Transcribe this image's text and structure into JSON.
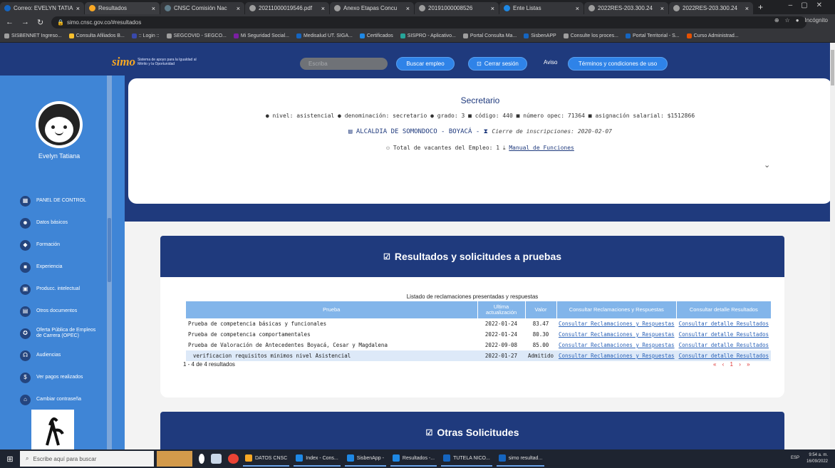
{
  "browser": {
    "tabs": [
      {
        "label": "Correo: EVELYN TATIA",
        "color": "#1565c0"
      },
      {
        "label": "Resultados",
        "color": "#f9a825"
      },
      {
        "label": "CNSC Comisión Nac",
        "color": "#607d8b"
      },
      {
        "label": "20211000019546.pdf",
        "color": "#9e9e9e"
      },
      {
        "label": "Anexo Etapas Concu",
        "color": "#9e9e9e"
      },
      {
        "label": "20191000008526",
        "color": "#9e9e9e"
      },
      {
        "label": "Ente Listas",
        "color": "#1e88e5"
      },
      {
        "label": "2022RES-203.300.24",
        "color": "#9e9e9e"
      },
      {
        "label": "2022RES-203.300.24",
        "color": "#9e9e9e"
      }
    ],
    "new_tab": "+",
    "url": "simo.cnsc.gov.co/#resultados",
    "incognito_label": "Incógnito",
    "bookmarks": [
      {
        "label": "SISBENNET Ingreso...",
        "color": "#9e9e9e"
      },
      {
        "label": "Consulta Afiliados B...",
        "color": "#fbc02d"
      },
      {
        "label": ":: Login ::",
        "color": "#3949ab"
      },
      {
        "label": "SEGCOVID - SEGCO...",
        "color": "#9e9e9e"
      },
      {
        "label": "Mi Seguridad Social...",
        "color": "#7b1fa2"
      },
      {
        "label": "Medisalud UT. SIGA...",
        "color": "#1565c0"
      },
      {
        "label": "Certificados",
        "color": "#1e88e5"
      },
      {
        "label": "SISPRO - Aplicativo...",
        "color": "#26a69a"
      },
      {
        "label": "Portal Consulta Ma...",
        "color": "#9e9e9e"
      },
      {
        "label": "SisbenAPP",
        "color": "#1565c0"
      },
      {
        "label": "Consulte los proces...",
        "color": "#9e9e9e"
      },
      {
        "label": "Portal Territorial - S...",
        "color": "#1565c0"
      },
      {
        "label": "Curso Administrad...",
        "color": "#e65100"
      }
    ]
  },
  "header": {
    "logo": "simo",
    "logo_caption": "Sistema de apoyo para la Igualdad al Mérito y la Oportunidad",
    "search_placeholder": "Escriba",
    "buscar_empleo": "Buscar empleo",
    "cerrar_sesion": "Cerrar sesión",
    "aviso": "Aviso",
    "terminos": "Términos y condiciones de uso"
  },
  "sidebar": {
    "user_name": "Evelyn Tatiana",
    "items": [
      {
        "icon": "▦",
        "label": "PANEL DE CONTROL"
      },
      {
        "icon": "☻",
        "label": "Datos básicos"
      },
      {
        "icon": "◆",
        "label": "Formación"
      },
      {
        "icon": "■",
        "label": "Experiencia"
      },
      {
        "icon": "▣",
        "label": "Producc. intelectual"
      },
      {
        "icon": "▤",
        "label": "Otros documentos"
      },
      {
        "icon": "✪",
        "label": "Oferta Pública de Empleos de Carrera (OPEC)"
      },
      {
        "icon": "☊",
        "label": "Audiencias"
      },
      {
        "icon": "$",
        "label": "Ver pagos realizados"
      },
      {
        "icon": "⌂",
        "label": "Cambiar contraseña"
      }
    ]
  },
  "job": {
    "title": "Secretario",
    "nivel": "nivel: asistencial",
    "denominacion": "denominación: secretario",
    "grado": "grado: 3",
    "codigo": "código: 440",
    "numero_opec": "número opec: 71364",
    "asignacion": "asignación salarial: $1512866",
    "entidad": "ALCALDIA DE SOMONDOCO - BOYACÁ -",
    "cierre": "Cierre de inscripciones: 2020-02-07",
    "vacantes": "Total de vacantes del Empleo: 1",
    "manual": "Manual de Funciones"
  },
  "results": {
    "title": "Resultados y solicitudes a pruebas",
    "caption": "Listado de reclamaciones presentadas y respuestas",
    "columns": [
      "Prueba",
      "Ultima actualización",
      "Valor",
      "Consultar Reclamaciones y Respuestas",
      "Consultar detalle Resultados"
    ],
    "rows": [
      {
        "prueba": "Prueba de competencia básicas y funcionales",
        "fecha": "2022-01-24",
        "valor": "83.47",
        "reclamaciones": "Consultar Reclamaciones y Respuestas",
        "detalle": "Consultar detalle Resultados"
      },
      {
        "prueba": "Prueba de competencia comportamentales",
        "fecha": "2022-01-24",
        "valor": "80.30",
        "reclamaciones": "Consultar Reclamaciones y Respuestas",
        "detalle": "Consultar detalle Resultados"
      },
      {
        "prueba": "Prueba de Valoración de Antecedentes Boyacá, Cesar y Magdalena",
        "fecha": "2022-09-08",
        "valor": "85.00",
        "reclamaciones": "Consultar Reclamaciones y Respuestas",
        "detalle": "Consultar detalle Resultados"
      },
      {
        "prueba": "verificacion requisitos minimos nivel Asistencial",
        "fecha": "2022-01-27",
        "valor": "Admitido",
        "reclamaciones": "Consultar Reclamaciones y Respuestas",
        "detalle": "Consultar detalle Resultados"
      }
    ],
    "count": "1 - 4 de 4 resultados",
    "pager": "« ‹ 1 › »"
  },
  "otras": {
    "title": "Otras Solicitudes"
  },
  "taskbar": {
    "search_placeholder": "Escribe aquí para buscar",
    "apps": [
      {
        "label": "DATOS CNSC",
        "color": "#f9a825"
      },
      {
        "label": "Index - Cons...",
        "color": "#1e88e5"
      },
      {
        "label": "SisbenApp -",
        "color": "#1e88e5"
      },
      {
        "label": "Resultados -...",
        "color": "#1e88e5"
      },
      {
        "label": "TUTELA NICO...",
        "color": "#1565c0"
      },
      {
        "label": "simo resultad...",
        "color": "#1565c0"
      }
    ],
    "lang": "ESP",
    "time": "9:54 a. m.",
    "date": "16/09/2022"
  }
}
